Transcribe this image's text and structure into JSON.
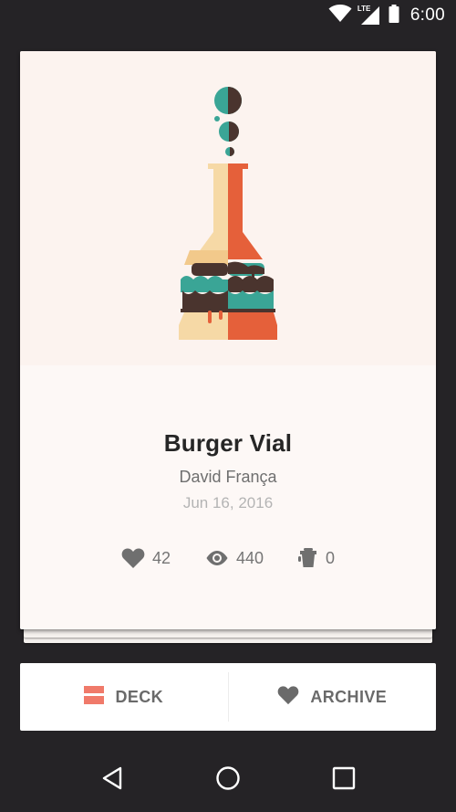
{
  "status_bar": {
    "network_label": "LTE",
    "time": "6:00"
  },
  "card": {
    "title": "Burger Vial",
    "author": "David França",
    "date": "Jun 16, 2016",
    "stats": {
      "likes": "42",
      "views": "440",
      "buckets": "0"
    }
  },
  "actions": {
    "deck_label": "DECK",
    "archive_label": "ARCHIVE"
  },
  "colors": {
    "background": "#252326",
    "card": "#fcf7f5",
    "teal": "#3aa596",
    "orange": "#e5603a",
    "cream": "#f6d9a6",
    "brown": "#4a342e",
    "deck_accent": "#f07a6a"
  },
  "icons": {
    "wifi": "wifi-icon",
    "signal": "signal-icon",
    "battery": "battery-icon",
    "like": "heart-icon",
    "views": "eye-icon",
    "bucket": "bucket-icon",
    "deck": "deck-icon",
    "archive": "heart-icon",
    "back": "back-triangle-icon",
    "home": "home-circle-icon",
    "recents": "recents-square-icon"
  }
}
